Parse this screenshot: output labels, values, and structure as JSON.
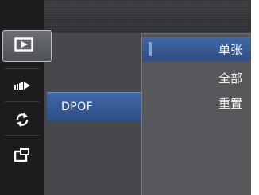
{
  "menu": {
    "side_tabs": [
      {
        "name": "playback",
        "icon": "playback-icon",
        "selected": true
      },
      {
        "name": "burst",
        "icon": "burst-icon",
        "selected": false
      },
      {
        "name": "rotate",
        "icon": "rotate-icon",
        "selected": false
      },
      {
        "name": "setup",
        "icon": "setup-icon",
        "selected": false
      }
    ],
    "active_item": "DPOF",
    "options": [
      "单张",
      "全部",
      "重置"
    ],
    "selected_option": "单张"
  },
  "colors": {
    "selection_blue": "#3a5c97",
    "sidebar_bg": "#1c1c1e",
    "panel_bg": "#46484b",
    "submenu_bg": "#55575a"
  }
}
